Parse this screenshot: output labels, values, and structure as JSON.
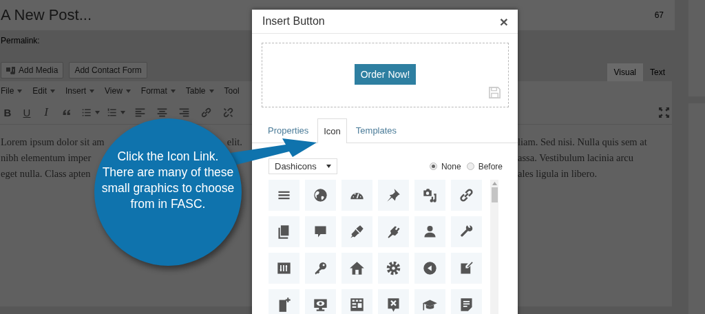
{
  "editor": {
    "title": "A New Post...",
    "word_count": "67",
    "permalink_label": "Permalink:",
    "media_buttons": [
      {
        "kind": "media",
        "label": "Add Media"
      },
      {
        "kind": "plain",
        "label": "Add Contact Form"
      }
    ],
    "mode_tabs": [
      {
        "label": "Visual",
        "selected": true
      },
      {
        "label": "Text",
        "selected": false
      }
    ],
    "menu": [
      {
        "label": "File",
        "caret": true
      },
      {
        "label": "Edit",
        "caret": true
      },
      {
        "label": "Insert",
        "caret": true
      },
      {
        "label": "View",
        "caret": true
      },
      {
        "label": "Format",
        "caret": true
      },
      {
        "label": "Table",
        "caret": true
      },
      {
        "label": "Tool",
        "caret": false
      }
    ],
    "toolbar": [
      {
        "kind": "bold",
        "label": "B"
      },
      {
        "kind": "underline",
        "label": "U"
      },
      {
        "kind": "italic",
        "label": "I"
      },
      {
        "kind": "quote"
      },
      {
        "kind": "bullets"
      },
      {
        "kind": "numbers"
      },
      {
        "kind": "align-left"
      },
      {
        "kind": "align-center"
      },
      {
        "kind": "align-right"
      },
      {
        "kind": "link"
      },
      {
        "kind": "unlink"
      }
    ],
    "lines": [
      {
        "left": "Lorem ipsum dolor sit am",
        "left_end": "elit.",
        "right": "liam. Sed nisi. Nulla quis sem at"
      },
      {
        "left": "nibh elementum imper",
        "right": "assa. Vestibulum lacinia arcu"
      },
      {
        "left": "eget nulla. Class apten",
        "right": "ales ligula in libero."
      }
    ]
  },
  "dialog": {
    "title": "Insert Button",
    "close": "×",
    "preview_button": "Order Now!",
    "tabs": [
      {
        "label": "Properties",
        "selected": false
      },
      {
        "label": "Icon",
        "selected": true
      },
      {
        "label": "Templates",
        "selected": false
      }
    ],
    "icon_set": "Dashicons",
    "position_options": [
      {
        "label": "None",
        "selected": true
      },
      {
        "label": "Before",
        "selected": false
      }
    ],
    "icons": [
      {
        "kind": "menu"
      },
      {
        "kind": "globe"
      },
      {
        "kind": "gauge"
      },
      {
        "kind": "pin"
      },
      {
        "kind": "media"
      },
      {
        "kind": "link"
      },
      {
        "kind": "pages"
      },
      {
        "kind": "comment"
      },
      {
        "kind": "brush"
      },
      {
        "kind": "plug"
      },
      {
        "kind": "user"
      },
      {
        "kind": "wrench"
      },
      {
        "kind": "sliders"
      },
      {
        "kind": "key"
      },
      {
        "kind": "home"
      },
      {
        "kind": "gear"
      },
      {
        "kind": "back"
      },
      {
        "kind": "edit"
      },
      {
        "kind": "add-page"
      },
      {
        "kind": "monitor"
      },
      {
        "kind": "table"
      },
      {
        "kind": "x-bubble"
      },
      {
        "kind": "cap"
      },
      {
        "kind": "note"
      }
    ]
  },
  "callout": {
    "text": "Click the Icon Link. There are many of these small graphics to choose from in FASC."
  }
}
